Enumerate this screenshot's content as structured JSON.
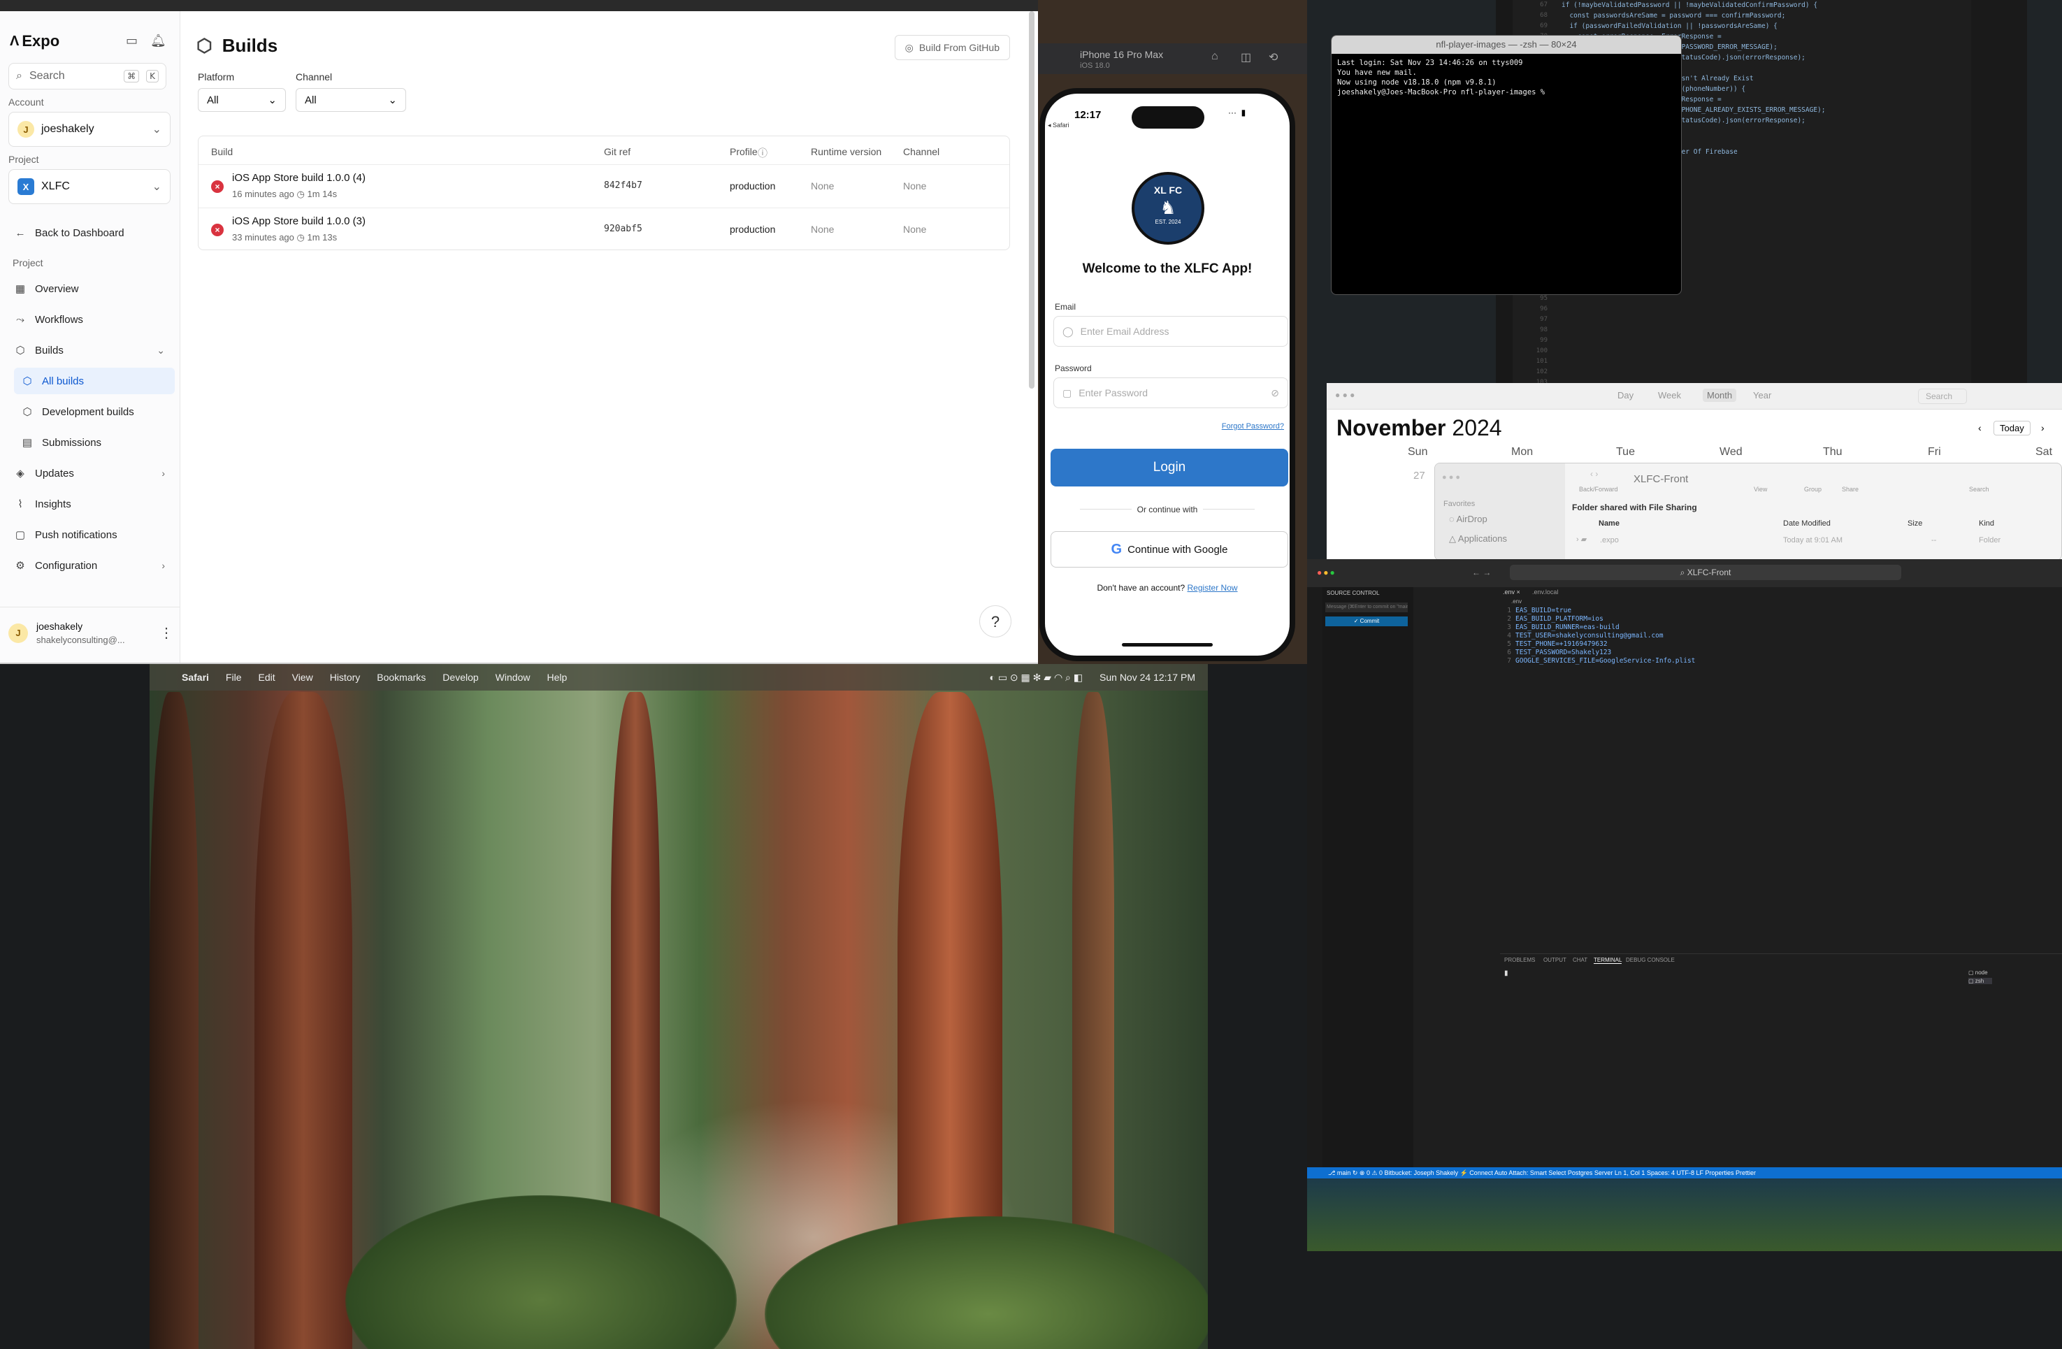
{
  "expo": {
    "logo": "Expo",
    "search": {
      "placeholder": "Search",
      "shortcut_cmd": "⌘",
      "shortcut_key": "K"
    },
    "account": {
      "label": "Account",
      "name": "joeshakely",
      "initial": "J"
    },
    "project": {
      "label": "Project",
      "name": "XLFC",
      "initial": "X"
    },
    "back": "Back to Dashboard",
    "nav_section": "Project",
    "nav": [
      {
        "label": "Overview",
        "icon": "grid-icon"
      },
      {
        "label": "Workflows",
        "icon": "workflow-icon"
      },
      {
        "label": "Builds",
        "icon": "cube-icon"
      },
      {
        "label": "All builds",
        "icon": "cube-icon"
      },
      {
        "label": "Development builds",
        "icon": "cube-icon"
      },
      {
        "label": "Submissions",
        "icon": "submissions-icon"
      },
      {
        "label": "Updates",
        "icon": "updates-icon"
      },
      {
        "label": "Insights",
        "icon": "insights-icon"
      },
      {
        "label": "Push notifications",
        "icon": "bell-icon"
      },
      {
        "label": "Configuration",
        "icon": "config-icon"
      }
    ],
    "user": {
      "name": "joeshakely",
      "email": "shakelyconsulting@...",
      "initial": "J"
    },
    "page_title": "Builds",
    "github_button": "Build From GitHub",
    "filters": {
      "platform_label": "Platform",
      "platform_value": "All",
      "channel_label": "Channel",
      "channel_value": "All"
    },
    "table": {
      "headers": [
        "Build",
        "Git ref",
        "Profile",
        "Runtime version",
        "Channel"
      ],
      "rows": [
        {
          "name": "iOS App Store build 1.0.0 (4)",
          "time": "16 minutes ago",
          "duration": "1m 14s",
          "git_ref": "842f4b7",
          "profile": "production",
          "runtime": "None",
          "channel": "None"
        },
        {
          "name": "iOS App Store build 1.0.0 (3)",
          "time": "33 minutes ago",
          "duration": "1m 13s",
          "git_ref": "920abf5",
          "profile": "production",
          "runtime": "None",
          "channel": "None"
        }
      ]
    },
    "help": "?"
  },
  "simulator": {
    "device": "iPhone 16 Pro Max",
    "os": "iOS 18.0",
    "time": "12:17",
    "back_app": "◂ Safari",
    "badge_top": "XL FC",
    "badge_bottom": "EST. 2024",
    "welcome": "Welcome to the XLFC App!",
    "email_label": "Email",
    "email_placeholder": "Enter Email Address",
    "password_label": "Password",
    "password_placeholder": "Enter Password",
    "forgot": "Forgot Password?",
    "login": "Login",
    "or": "Or continue with",
    "google": "Continue with Google",
    "register_prompt": "Don't have an account?",
    "register_link": "Register Now"
  },
  "terminal": {
    "title": "nfl-player-images — -zsh — 80×24",
    "lines": "Last login: Sat Nov 23 14:46:26 on ttys009\nYou have new mail.\nNow using node v18.18.0 (npm v9.8.1)\njoeshakely@Joes-MacBook-Pro nfl-player-images % "
  },
  "calendar": {
    "tabs": [
      "Day",
      "Week",
      "Month",
      "Year"
    ],
    "month": "November",
    "year": "2024",
    "today": "Today",
    "search_placeholder": "Search",
    "days": [
      "Sun",
      "Mon",
      "Tue",
      "Wed",
      "Thu",
      "Fri",
      "Sat"
    ],
    "first_date": "27"
  },
  "finder": {
    "title": "XLFC-Front",
    "shared": "Folder shared with File Sharing",
    "favorites": "Favorites",
    "sidebar": [
      "AirDrop",
      "Applications"
    ],
    "columns": [
      "Name",
      "Date Modified",
      "Size",
      "Kind"
    ],
    "row": {
      "name": ".expo",
      "date": "Today at 9:01 AM",
      "size": "--",
      "kind": "Folder"
    },
    "toolbar": {
      "back_forward": "Back/Forward",
      "view": "View",
      "group": "Group",
      "share": "Share",
      "search": "Search"
    }
  },
  "vscode": {
    "title": "XLFC-Front",
    "source_control": "SOURCE CONTROL",
    "message_placeholder": "Message (⌘Enter to commit on \"main\")",
    "commit": "✓ Commit",
    "tabs": [
      ".env",
      ".env.local"
    ],
    "file_label": ".env",
    "env": "EAS_BUILD=true\nEAS_BUILD_PLATFORM=ios\nEAS_BUILD_RUNNER=eas-build\nTEST_USER=shakelyconsulting@gmail.com\nTEST_PHONE=+19169479632\nTEST_PASSWORD=Shakely123\nGOOGLE_SERVICES_FILE=GoogleService-Info.plist",
    "line_numbers": "1\n2\n3\n4\n5\n6\n7",
    "panel_tabs": [
      "PROBLEMS",
      "OUTPUT",
      "CHAT",
      "TERMINAL",
      "DEBUG CONSOLE"
    ],
    "terminals": [
      "node",
      "zsh"
    ],
    "status": "⎇ main ↻   ⊗ 0 ⚠ 0   Bitbucket: Joseph Shakely   ⚡ Connect   Auto Attach: Smart   Select Postgres Server        Ln 1, Col 1   Spaces: 4   UTF-8   LF   Properties   Prettier"
  },
  "code_editor": {
    "text": "if (!maybeValidatedPassword || !maybeValidatedConfirmPassword) {\n  const passwordsAreSame = password === confirmPassword;\n  if (passwordFailedValidation || !passwordsAreSame) {\n    const errorResponse: ErrorResponse =\n      buildErrorResponse(400, PASSWORD_ERROR_MESSAGE);\n    res.status(errorResponse.statusCode).json(errorResponse);\n  }\n  // Ensuring Phone Number Doesn't Already Exist\n  if (await phoneAlreadyExists(phoneNumber)) {\n    const errorResponse: ErrorResponse =\n      buildErrorResponse(400, PHONE_ALREADY_EXISTS_ERROR_MESSAGE);\n    res.status(errorResponse.statusCode).json(errorResponse);\n    return;\n  }\n  // Creating User In Auth Layer Of Firebase"
  },
  "desktop_menu": {
    "app": "Safari",
    "items": [
      "File",
      "Edit",
      "View",
      "History",
      "Bookmarks",
      "Develop",
      "Window",
      "Help"
    ],
    "clock": "Sun Nov 24  12:17 PM"
  }
}
